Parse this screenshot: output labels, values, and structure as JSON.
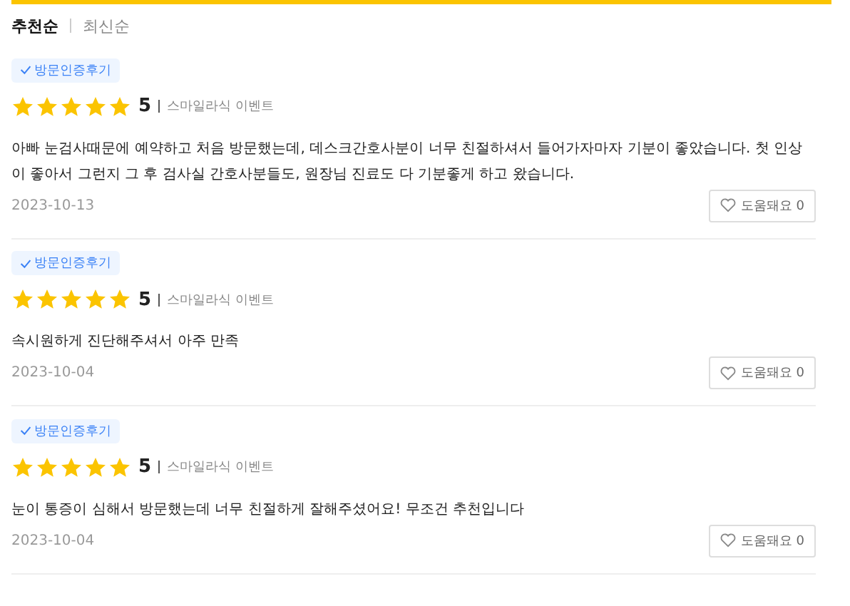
{
  "sort_tabs": [
    {
      "label": "추천순",
      "selected": true
    },
    {
      "label": "최신순",
      "selected": false
    }
  ],
  "reviews": [
    {
      "badge": "방문인증후기",
      "stars": 5,
      "score": "5",
      "event": "스마일라식 이벤트",
      "text": "아빠 눈검사때문에 예약하고 처음 방문했는데, 데스크간호사분이 너무 친절하셔서 들어가자마자 기분이 좋았습니다. 첫 인상이 좋아서 그런지 그 후 검사실 간호사분들도, 원장님 진료도 다 기분좋게 하고 왔습니다.",
      "date": "2023-10-13",
      "helpful": "도움돼요 0",
      "liked": false
    },
    {
      "badge": "방문인증후기",
      "stars": 5,
      "score": "5",
      "event": "스마일라식 이벤트",
      "text": "속시원하게 진단해주셔서 아주 만족",
      "date": "2023-10-04",
      "helpful": "도움돼요 0",
      "liked": false
    },
    {
      "badge": "방문인증후기",
      "stars": 5,
      "score": "5",
      "event": "스마일라식 이벤트",
      "text": "눈이 통증이 심해서 방문했는데 너무 친절하게 잘해주셨어요! 무조건 추천입니다",
      "date": "2023-10-04",
      "helpful": "도움돼요 0",
      "liked": false
    }
  ]
}
